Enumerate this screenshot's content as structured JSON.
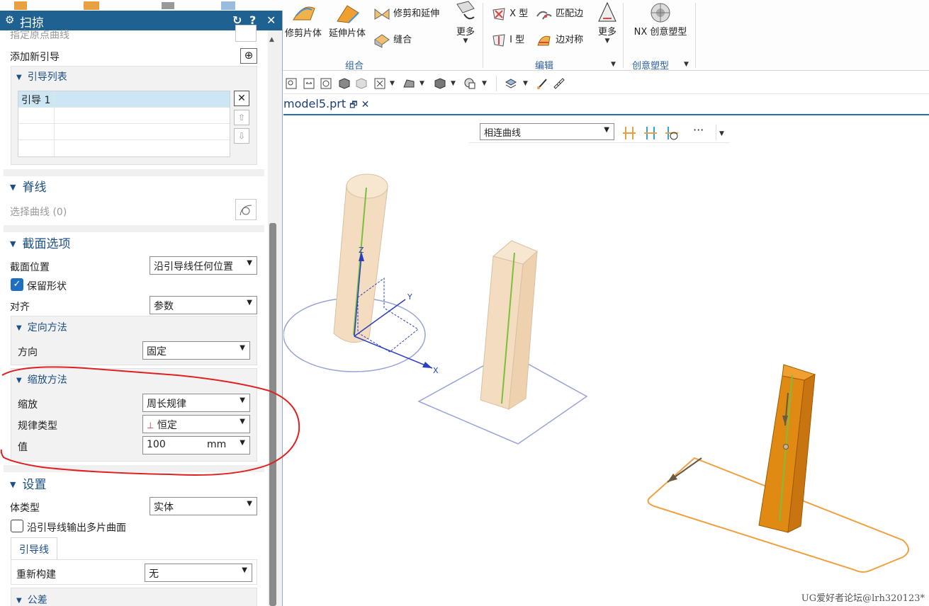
{
  "ribbon": {
    "trim_sheet": "修剪片体",
    "extend_sheet": "延伸片体",
    "trim_extend": "修剪和延伸",
    "sew": "缝合",
    "more1": "更多",
    "group_combine": "组合",
    "x_type": "X 型",
    "i_type": "I 型",
    "match_edge": "匹配边",
    "edge_symmetry": "边对称",
    "more2": "更多",
    "group_edit": "编辑",
    "nx_creative": "NX 创意塑型",
    "group_creative": "创意塑型"
  },
  "tab": {
    "file": "model5.prt"
  },
  "filter": {
    "curve_rule": "相连曲线",
    "more_dots": "···"
  },
  "dialog": {
    "title": "扫掠",
    "clipped_label": "指定原点曲线",
    "add_guide": "添加新引导",
    "guide_list_head": "引导列表",
    "guide_rows": [
      "引导 1",
      "",
      "",
      ""
    ],
    "spine_head": "脊线",
    "select_curve": "选择曲线 (0)",
    "section_options_head": "截面选项",
    "section_position_label": "截面位置",
    "section_position_value": "沿引导线任何位置",
    "preserve_shape": "保留形状",
    "align_label": "对齐",
    "align_value": "参数",
    "orientation_head": "定向方法",
    "direction_label": "方向",
    "direction_value": "固定",
    "scaling_head": "缩放方法",
    "scale_label": "缩放",
    "scale_value": "周长规律",
    "law_type_label": "规律类型",
    "law_type_value": "恒定",
    "value_label": "值",
    "value_value": "100",
    "value_unit": "mm",
    "settings_head": "设置",
    "body_type_label": "体类型",
    "body_type_value": "实体",
    "multi_face_label": "沿引导线输出多片曲面",
    "guide_tab": "引导线",
    "rebuild_label": "重新构建",
    "rebuild_value": "无",
    "tolerance_head": "公差"
  },
  "viewport": {
    "axis_x": "X",
    "axis_y": "Y",
    "axis_z": "Z",
    "watermark": "UG爱好者论坛@lrh320123*"
  },
  "colors": {
    "title_bar": "#1f6191",
    "section_header": "#1b4f86",
    "annotation_red": "#e02020",
    "solid_tan": "#f3dcc0",
    "solid_orange": "#e08a14",
    "guide_green": "#7bbf3a"
  }
}
